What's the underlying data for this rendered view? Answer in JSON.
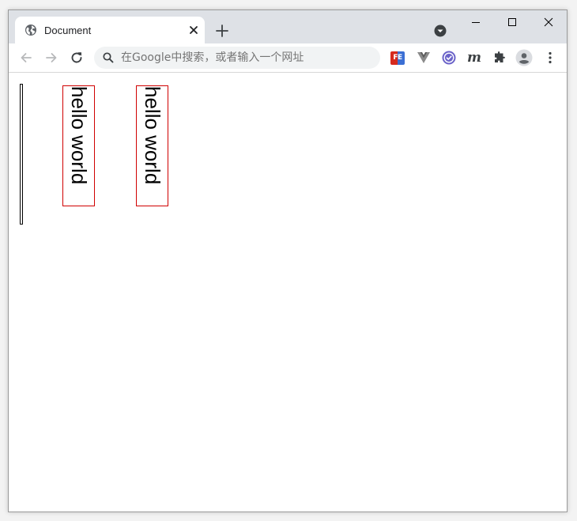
{
  "tab": {
    "title": "Document",
    "favicon": "globe-icon"
  },
  "omnibox": {
    "placeholder": "在Google中搜索，或者输入一个网址"
  },
  "extensions": {
    "fe_label": "FE",
    "m_label": "m"
  },
  "content": {
    "text_1": "hello world",
    "text_2": "hello world"
  },
  "colors": {
    "tabstrip_bg": "#dee1e6",
    "omnibox_bg": "#f1f3f4",
    "box_border": "#d00000",
    "fe_red": "#d62a1e",
    "fe_blue": "#3b6fd4",
    "vue_gray": "#7a7a7a",
    "check_purple": "#6b63c9"
  }
}
